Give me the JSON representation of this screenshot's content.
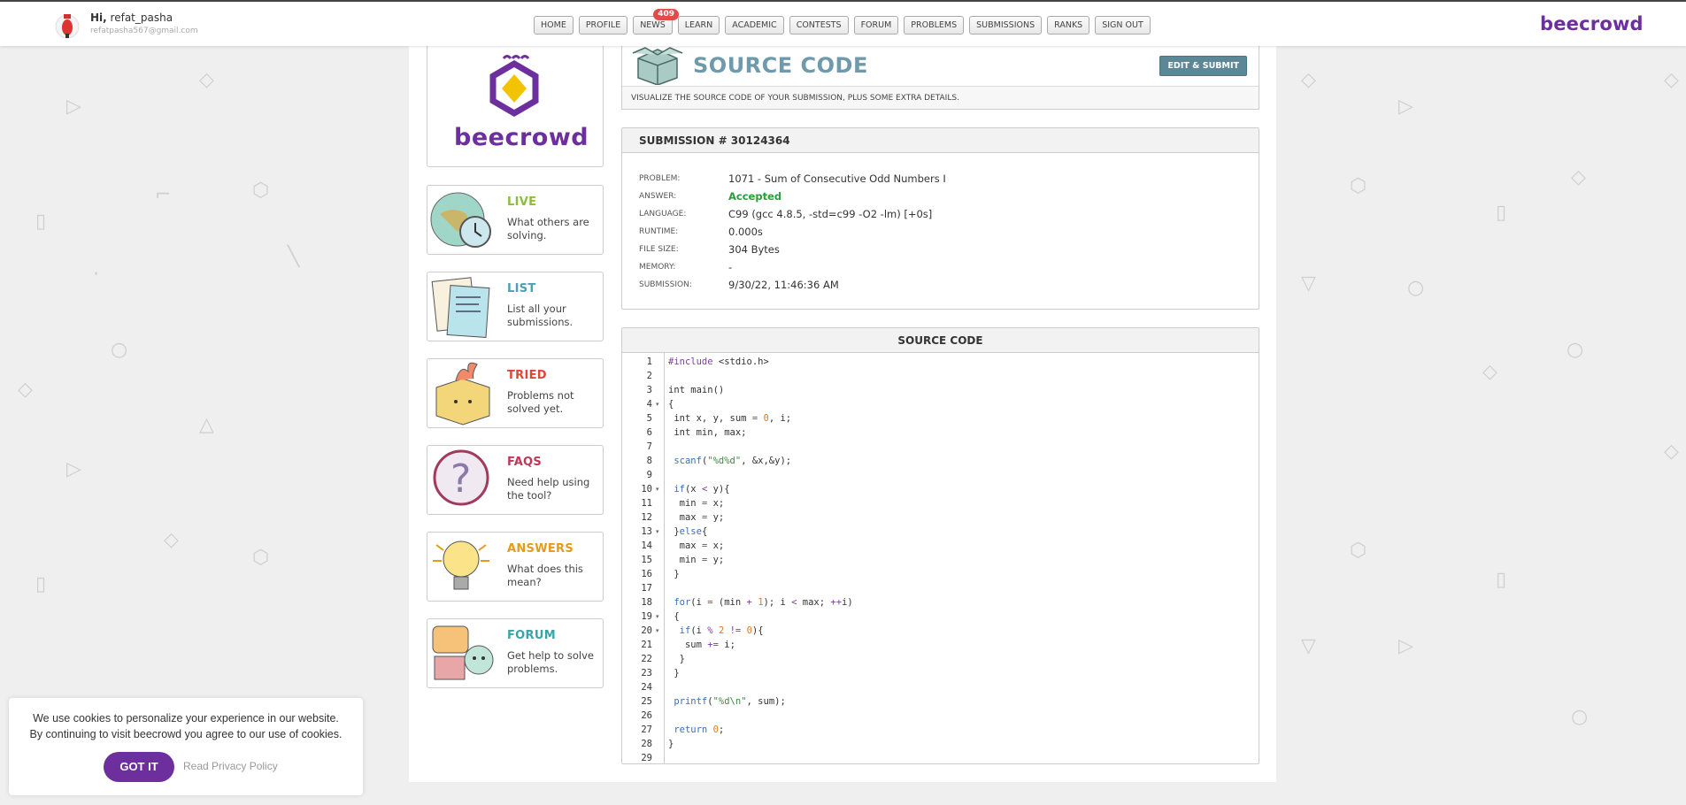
{
  "header": {
    "greeting_prefix": "Hi,",
    "username": "refat_pasha",
    "email": "refatpasha567@gmail.com",
    "brand": "beecrowd",
    "nav": [
      {
        "label": "HOME"
      },
      {
        "label": "PROFILE"
      },
      {
        "label": "NEWS",
        "badge": "409"
      },
      {
        "label": "LEARN"
      },
      {
        "label": "ACADEMIC"
      },
      {
        "label": "CONTESTS"
      },
      {
        "label": "FORUM"
      },
      {
        "label": "PROBLEMS"
      },
      {
        "label": "SUBMISSIONS"
      },
      {
        "label": "RANKS"
      },
      {
        "label": "SIGN OUT"
      }
    ]
  },
  "sidebar": {
    "logo_text": "beecrowd",
    "items": [
      {
        "title": "LIVE",
        "desc": "What others are solving.",
        "color": "#8bbd3c",
        "icon": "globe-clock-icon"
      },
      {
        "title": "LIST",
        "desc": "List all your submissions.",
        "color": "#4aa0b5",
        "icon": "papers-icon"
      },
      {
        "title": "TRIED",
        "desc": "Problems not solved yet.",
        "color": "#e0443a",
        "icon": "burning-box-icon"
      },
      {
        "title": "FAQS",
        "desc": "Need help using the tool?",
        "color": "#c0375a",
        "icon": "question-bubble-icon"
      },
      {
        "title": "ANSWERS",
        "desc": "What does this mean?",
        "color": "#e69a1c",
        "icon": "lightbulb-icon"
      },
      {
        "title": "FORUM",
        "desc": "Get help to solve problems.",
        "color": "#3aa3a8",
        "icon": "chat-bubbles-icon"
      }
    ]
  },
  "page": {
    "title": "SOURCE CODE",
    "edit_button": "EDIT & SUBMIT",
    "subtitle": "VISUALIZE THE SOURCE CODE OF YOUR SUBMISSION, PLUS SOME EXTRA DETAILS."
  },
  "submission": {
    "heading": "SUBMISSION # 30124364",
    "fields": [
      {
        "label": "PROBLEM:",
        "value": "1071 - Sum of Consecutive Odd Numbers I"
      },
      {
        "label": "ANSWER:",
        "value": "Accepted"
      },
      {
        "label": "LANGUAGE:",
        "value": "C99 (gcc 4.8.5, -std=c99 -O2 -lm) [+0s]"
      },
      {
        "label": "RUNTIME:",
        "value": "0.000s"
      },
      {
        "label": "FILE SIZE:",
        "value": "304 Bytes"
      },
      {
        "label": "MEMORY:",
        "value": "-"
      },
      {
        "label": "SUBMISSION:",
        "value": "9/30/22, 11:46:36 AM"
      }
    ],
    "accepted_color": "#2a9c3a"
  },
  "code": {
    "heading": "SOURCE CODE",
    "foldable_lines": [
      4,
      10,
      13,
      19,
      20
    ],
    "lines": [
      "#include <stdio.h>",
      "",
      "int main()",
      "{",
      " int x, y, sum = 0, i;",
      " int min, max;",
      "",
      " scanf(\"%d%d\", &x,&y);",
      "",
      " if(x < y){",
      "  min = x;",
      "  max = y;",
      " }else{",
      "  max = x;",
      "  min = y;",
      " }",
      "",
      " for(i = (min + 1); i < max; ++i)",
      " {",
      "  if(i % 2 != 0){",
      "   sum += i;",
      "  }",
      " }",
      "",
      " printf(\"%d\\n\", sum);",
      "",
      " return 0;",
      "}",
      ""
    ]
  },
  "cookie": {
    "message": "We use cookies to personalize your experience in our website. By continuing to visit beecrowd you agree to our use of cookies.",
    "accept": "GOT IT",
    "privacy": "Read Privacy Policy"
  },
  "colors": {
    "brand": "#6d2f9d",
    "title": "#6e9aab",
    "button": "#5b8796"
  }
}
